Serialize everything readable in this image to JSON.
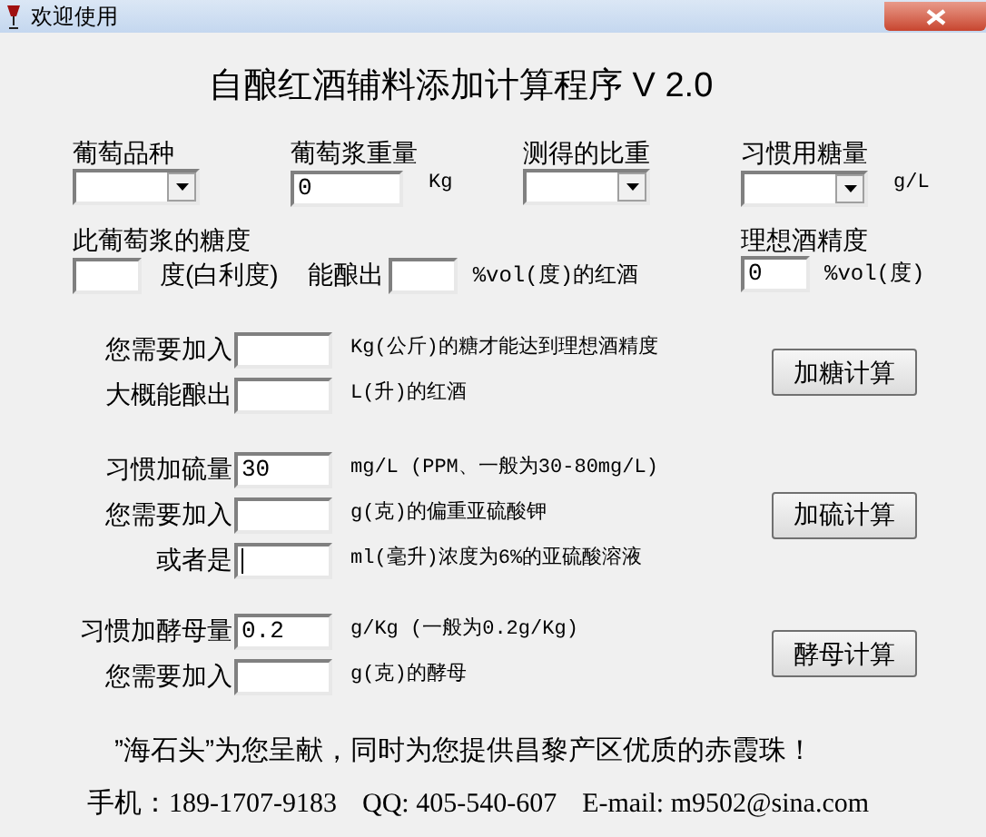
{
  "window": {
    "title": "欢迎使用"
  },
  "heading": "自酿红酒辅料添加计算程序 V 2.0",
  "top_fields": [
    {
      "label": "葡萄品种",
      "kind": "dropdown"
    },
    {
      "label": "葡萄浆重量",
      "kind": "text",
      "value": "0",
      "unit": "Kg"
    },
    {
      "label": "测得的比重",
      "kind": "dropdown"
    },
    {
      "label": "习惯用糖量",
      "kind": "dropdown",
      "unit": "g/L"
    }
  ],
  "must": {
    "label": "此葡萄浆的糖度",
    "unit": "度(白利度)",
    "yield_label": "能酿出",
    "yield_unit": "%vol(度)的红酒"
  },
  "target": {
    "label": "理想酒精度",
    "value": "0",
    "unit": "%vol(度)"
  },
  "sections": [
    {
      "rows": [
        {
          "label": "您需要加入",
          "unit": "Kg(公斤)的糖才能达到理想酒精度",
          "focused": false
        },
        {
          "label": "大概能酿出",
          "unit": "L(升)的红酒",
          "focused": false
        }
      ],
      "button": "加糖计算"
    },
    {
      "rows": [
        {
          "label": "习惯加硫量",
          "value": "30",
          "unit": "mg/L (PPM、一般为30-80mg/L)",
          "focused": false
        },
        {
          "label": "您需要加入",
          "unit": "g(克)的偏重亚硫酸钾",
          "focused": false
        },
        {
          "label": "或者是",
          "unit": "ml(毫升)浓度为6%的亚硫酸溶液",
          "focused": true
        }
      ],
      "button": "加硫计算"
    },
    {
      "rows": [
        {
          "label": "习惯加酵母量",
          "value": "0.2",
          "unit": "g/Kg (一般为0.2g/Kg)",
          "focused": false
        },
        {
          "label": "您需要加入",
          "unit": "g(克)的酵母",
          "focused": false
        }
      ],
      "button": "酵母计算"
    }
  ],
  "footer": {
    "credit": "”海石头”为您呈献，同时为您提供昌黎产区优质的赤霞珠！",
    "contacts": [
      "手机：189-1707-9183",
      "QQ: 405-540-607",
      "E-mail: m9502@sina.com"
    ]
  }
}
